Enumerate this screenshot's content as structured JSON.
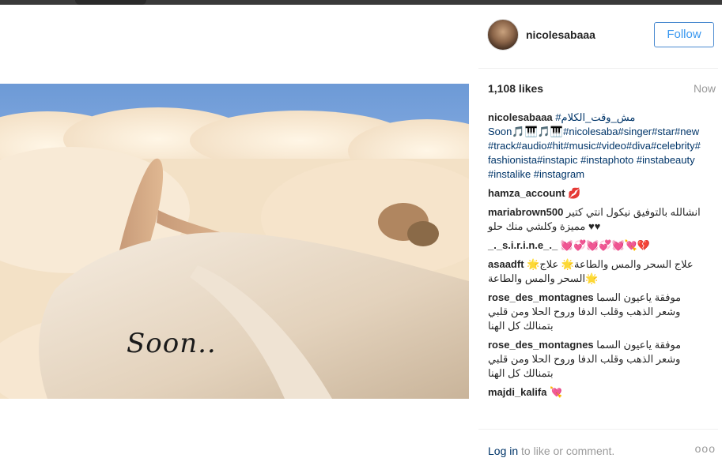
{
  "post": {
    "username": "nicolesabaaa",
    "follow_label": "Follow",
    "likes": "1,108 likes",
    "time": "Now",
    "image_overlay_text": "Soon.."
  },
  "caption": {
    "user": "nicolesabaaa",
    "line1": "#مش_وقت_الكلام",
    "line2": "Soon🎵🎹🎵🎹#nicolesaba#singer#star#new#track#audio#hit#music#video#diva#celebrity#fashionista#instapic #instaphoto #instabeauty #instalike #instagram"
  },
  "comments": [
    {
      "user": "hamza_account",
      "text": "💋"
    },
    {
      "user": "mariabrown500",
      "text": "انشالله بالتوفيق نيكول انتي كتير مميزة وكلشي منك حلو ♥♥"
    },
    {
      "user": "_._s.i.r.i.n.e_._",
      "text": "💓💞💓💞💓💘💔"
    },
    {
      "user": "asaadft",
      "text": "علاج السحر والمس والطاعة🌟 علاج🌟 السحر والمس والطاعة🌟"
    },
    {
      "user": "rose_des_montagnes",
      "text": "موفقة ياعيون السما وشعر الذهب وقلب الدفا وروح الحلا ومن قلبي بتمنالك كل الهنا"
    },
    {
      "user": "rose_des_montagnes",
      "text": "موفقة ياعيون السما وشعر الذهب وقلب الدفا وروح الحلا ومن قلبي بتمنالك كل الهنا"
    },
    {
      "user": "majdi_kalifa",
      "text": "💘"
    }
  ],
  "footer": {
    "login_link": "Log in",
    "login_rest": " to like or comment.",
    "more_label": "ooo"
  }
}
